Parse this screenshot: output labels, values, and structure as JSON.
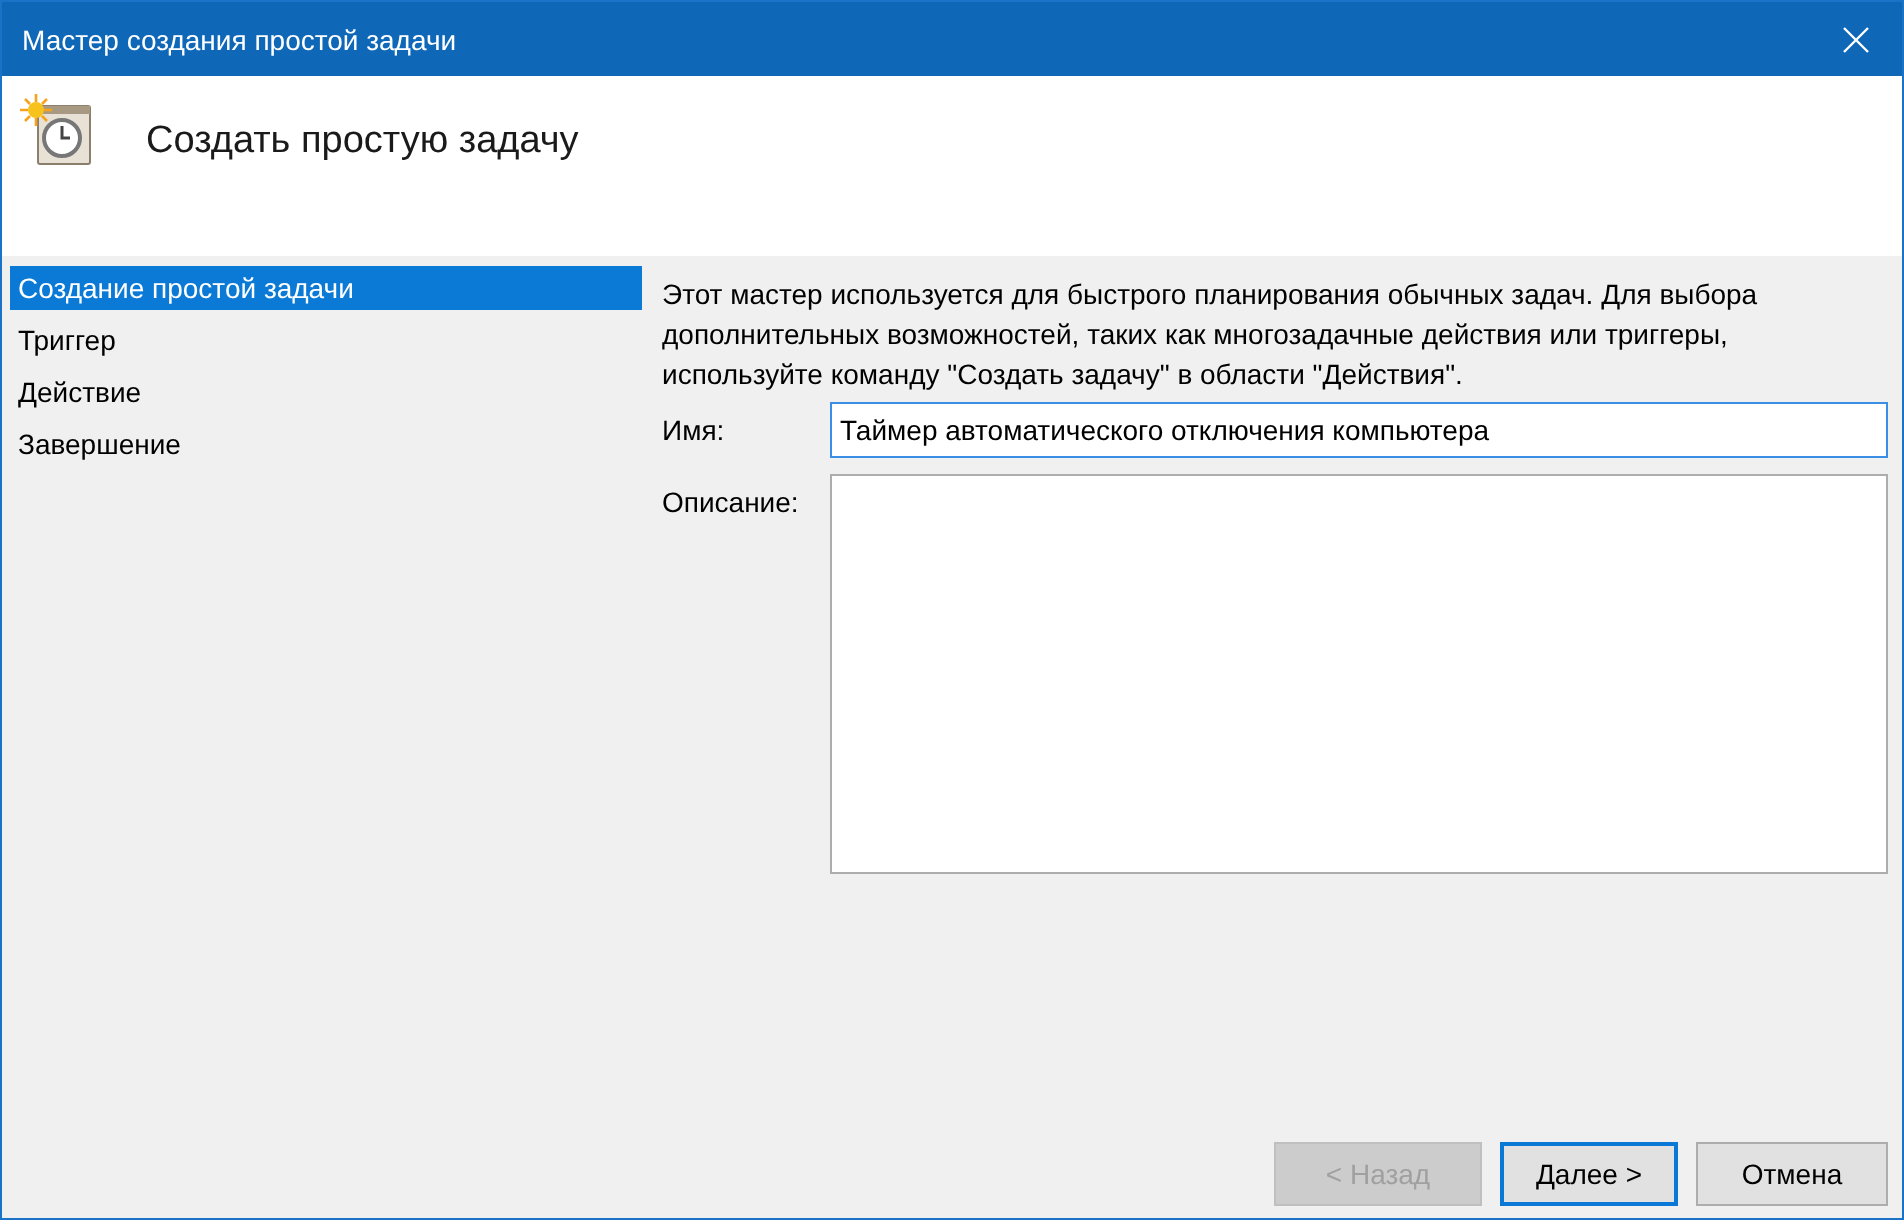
{
  "window": {
    "title": "Мастер создания простой задачи"
  },
  "header": {
    "title": "Создать простую задачу"
  },
  "steps": [
    {
      "label": "Создание простой задачи",
      "selected": true
    },
    {
      "label": "Триггер",
      "selected": false
    },
    {
      "label": "Действие",
      "selected": false
    },
    {
      "label": "Завершение",
      "selected": false
    }
  ],
  "intro": "Этот мастер используется для быстрого планирования обычных задач.  Для выбора дополнительных возможностей, таких как многозадачные действия или триггеры, используйте команду \"Создать задачу\" в области \"Действия\".",
  "name_field": {
    "label": "Имя:",
    "value": "Таймер автоматического отключения компьютера"
  },
  "description_field": {
    "label": "Описание:"
  },
  "buttons": [
    {
      "label": "< Назад",
      "disabled": true,
      "default": false
    },
    {
      "label": "Далее >",
      "disabled": false,
      "default": true
    },
    {
      "label": "Отмена",
      "disabled": false,
      "default": false
    }
  ]
}
